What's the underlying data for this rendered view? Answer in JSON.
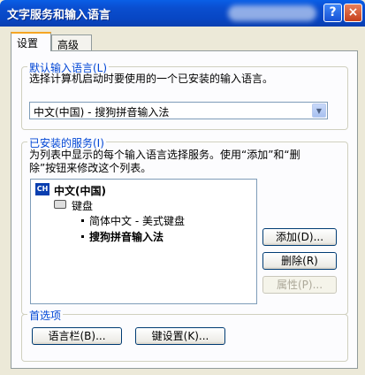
{
  "window": {
    "title": "文字服务和输入语言",
    "help_label": "?",
    "close_label": "×"
  },
  "tabs": [
    {
      "label": "设置"
    },
    {
      "label": "高级"
    }
  ],
  "default_language": {
    "group_title": "默认输入语言(L)",
    "description": "选择计算机启动时要使用的一个已安装的输入语言。",
    "selected": "中文(中国) - 搜狗拼音输入法"
  },
  "installed_services": {
    "group_title": "已安装的服务(I)",
    "description_line1": "为列表中显示的每个输入语言选择服务。使用“添加”和“删",
    "description_line2": "除”按钮来修改这个列表。",
    "language": {
      "badge": "CH",
      "label": "中文(中国)"
    },
    "category": "键盘",
    "items": [
      {
        "label": "简体中文 - 美式键盘"
      },
      {
        "label": "搜狗拼音输入法"
      }
    ],
    "buttons": {
      "add": "添加(D)...",
      "remove": "删除(R)",
      "properties": "属性(P)..."
    }
  },
  "preferences": {
    "group_title": "首选项",
    "language_bar": "语言栏(B)...",
    "key_settings": "键设置(K)..."
  }
}
